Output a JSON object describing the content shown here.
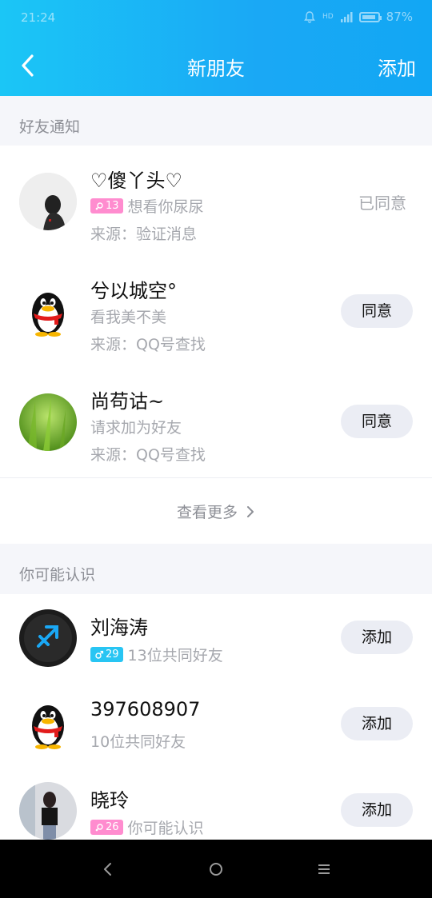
{
  "status": {
    "time": "21:24",
    "battery_pct": "87%",
    "hd": "HD"
  },
  "nav": {
    "title": "新朋友",
    "add_label": "添加"
  },
  "notifications": {
    "section_title": "好友通知",
    "items": [
      {
        "name": "♡傻丫头♡",
        "gender": "female",
        "age": "13",
        "message": "想看你尿尿",
        "source": "来源：验证消息",
        "status": "已同意"
      },
      {
        "name": "兮以城空°",
        "message": "看我美不美",
        "source": "来源：QQ号查找",
        "action": "同意"
      },
      {
        "name": "尚苟诂~",
        "message": "请求加为好友",
        "source": "来源：QQ号查找",
        "action": "同意"
      }
    ],
    "see_more": "查看更多"
  },
  "suggestions": {
    "section_title": "你可能认识",
    "items": [
      {
        "name": "刘海涛",
        "gender": "male",
        "age": "29",
        "message": "13位共同好友",
        "action": "添加"
      },
      {
        "name": "397608907",
        "message": "10位共同好友",
        "action": "添加"
      },
      {
        "name": "晓玲",
        "gender": "female",
        "age": "26",
        "message": "你可能认识",
        "action": "添加"
      }
    ]
  }
}
